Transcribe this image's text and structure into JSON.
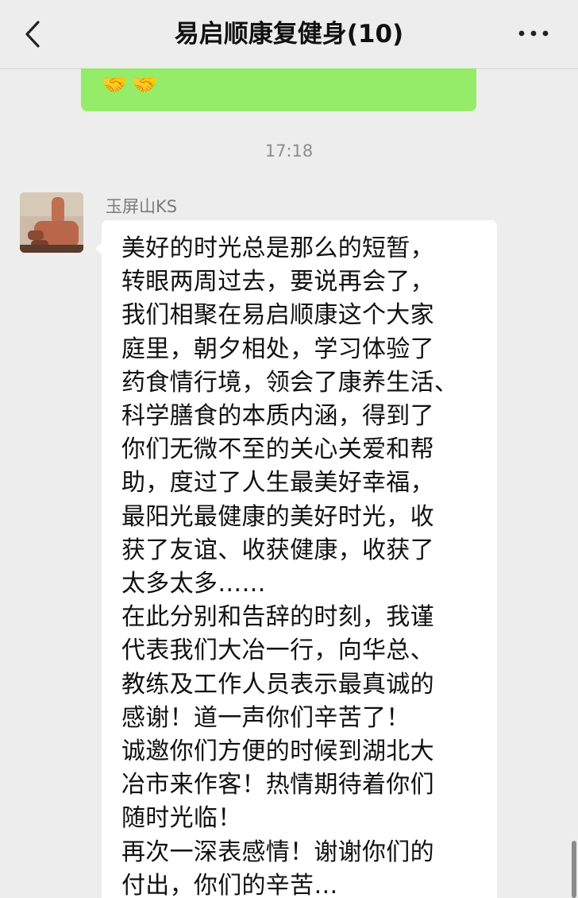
{
  "header": {
    "title": "易启顺康复健身(10)",
    "back_icon": "chevron-left-icon",
    "more_icon": "more-dots-icon"
  },
  "previous_message": {
    "emojis": [
      "🤝",
      "🤝"
    ],
    "bubble_color": "#95ec69"
  },
  "timestamp": "17:18",
  "message": {
    "sender": "玉屏山KS",
    "text": "美好的时光总是那么的短暂，\n转眼两周过去，要说再会了，\n我们相聚在易启顺康这个大家\n庭里，朝夕相处，学习体验了\n药食情行境，领会了康养生活、\n科学膳食的本质内涵，得到了\n你们无微不至的关心关爱和帮\n助，度过了人生最美好幸福，\n最阳光最健康的美好时光，收\n获了友谊、收获健康，收获了\n太多太多……\n在此分别和告辞的时刻，我谨\n代表我们大冶一行，向华总、\n教练及工作人员表示最真诚的\n感谢！道一声你们辛苦了！\n诚邀你们方便的时候到湖北大\n冶市来作客！热情期待着你们\n随时光临！\n再次一深表感情！谢谢你们的\n付出，你们的辛苦…",
    "bubble_color": "#ffffff"
  },
  "colors": {
    "background": "#ededed",
    "green_bubble": "#95ec69"
  }
}
